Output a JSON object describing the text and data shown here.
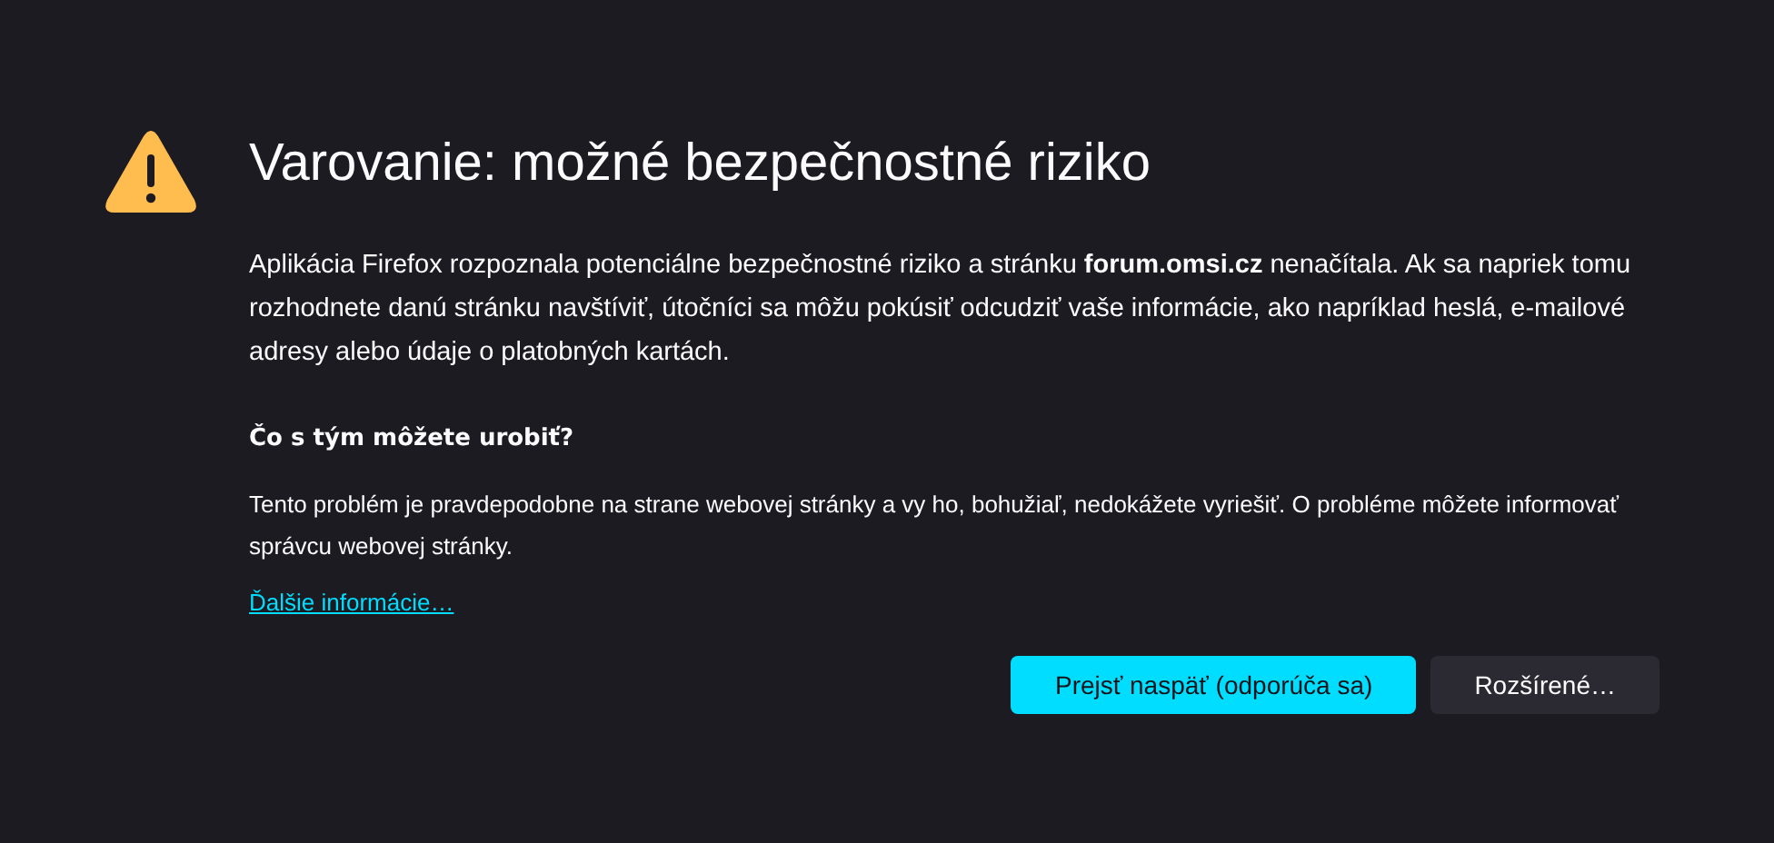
{
  "title": "Varovanie: možné bezpečnostné riziko",
  "intro": "Aplikácia Firefox rozpoznala potenciálne bezpečnostné riziko a stránku **forum.omsi.cz** nenačítala. Ak sa napriek tomu rozhodnete danú stránku navštíviť, útočníci sa môžu pokúsiť odcudziť vaše informácie, ako napríklad heslá, e-mailové adresy alebo údaje o platobných kartách.",
  "what_heading": "Čo s tým môžete urobiť?",
  "what_text": "Tento problém je pravdepodobne na strane webovej stránky a vy ho, bohužiaľ, nedokážete vyriešiť. O probléme môžete informovať správcu webovej stránky.",
  "link": "Ďalšie informácie…",
  "buttons": [
    {
      "label": "Prejsť naspäť (odporúča sa)",
      "kind": "primary"
    },
    {
      "label": "Rozšírené…",
      "kind": "secondary"
    }
  ]
}
